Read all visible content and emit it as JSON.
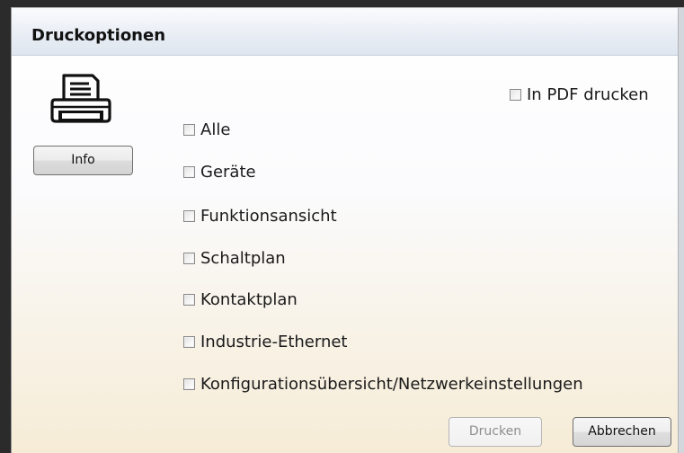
{
  "dialog": {
    "title": "Druckoptionen",
    "info_label": "Info",
    "pdf": {
      "label": "In PDF drucken",
      "checked": false
    },
    "options": [
      {
        "label": "Alle",
        "checked": false
      },
      {
        "label": "Geräte",
        "checked": false
      },
      {
        "label": "Funktionsansicht",
        "checked": false
      },
      {
        "label": "Schaltplan",
        "checked": false
      },
      {
        "label": "Kontaktplan",
        "checked": false
      },
      {
        "label": "Industrie-Ethernet",
        "checked": false
      },
      {
        "label": "Konfigurationsübersicht/Netzwerkeinstellungen",
        "checked": false
      }
    ],
    "print_label": "Drucken",
    "print_enabled": false,
    "cancel_label": "Abbrechen"
  },
  "icons": {
    "printer": "printer-icon"
  }
}
